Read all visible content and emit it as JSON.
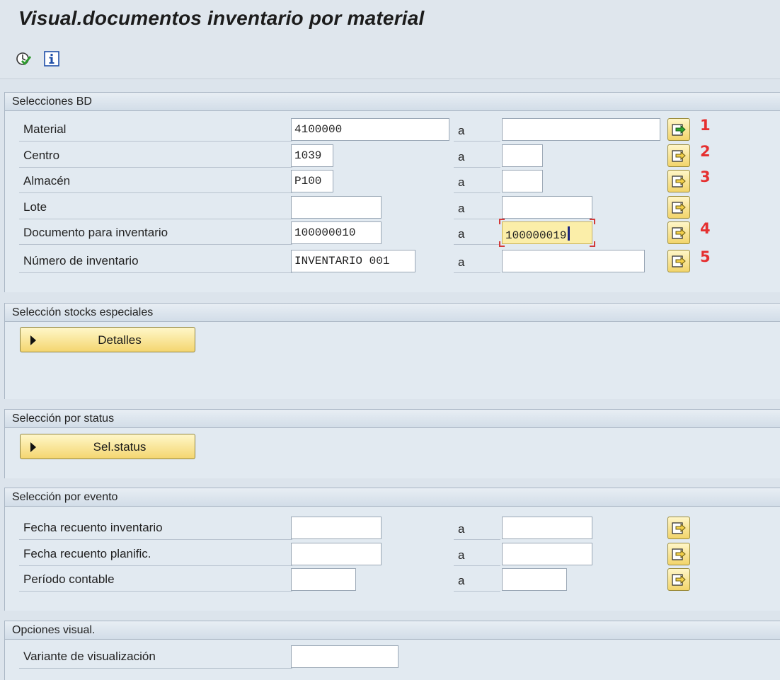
{
  "title": "Visual.documentos inventario por material",
  "toolbar": {
    "icons": [
      "execute-icon",
      "info-icon"
    ]
  },
  "sections": {
    "bd": {
      "header": "Selecciones BD",
      "rows": [
        {
          "label": "Material",
          "from": "4100000",
          "sep": "a",
          "to": "",
          "marker": "1"
        },
        {
          "label": "Centro",
          "from": "1039",
          "sep": "a",
          "to": "",
          "marker": "2"
        },
        {
          "label": "Almacén",
          "from": "P100",
          "sep": "a",
          "to": "",
          "marker": "3"
        },
        {
          "label": "Lote",
          "from": "",
          "sep": "a",
          "to": "",
          "marker": ""
        },
        {
          "label": "Documento para inventario",
          "from": "100000010",
          "sep": "a",
          "to": "100000019",
          "marker": "4"
        },
        {
          "label": "Número de inventario",
          "from": "INVENTARIO 001",
          "sep": "a",
          "to": "",
          "marker": "5"
        }
      ]
    },
    "stocks": {
      "header": "Selección stocks especiales",
      "button": "Detalles"
    },
    "status": {
      "header": "Selección por status",
      "button": "Sel.status"
    },
    "evento": {
      "header": "Selección por evento",
      "rows": [
        {
          "label": "Fecha recuento inventario",
          "from": "",
          "sep": "a",
          "to": ""
        },
        {
          "label": "Fecha recuento planific.",
          "from": "",
          "sep": "a",
          "to": ""
        },
        {
          "label": "Período contable",
          "from": "",
          "sep": "a",
          "to": ""
        }
      ]
    },
    "visual": {
      "header": "Opciones visual.",
      "rows": [
        {
          "label": "Variante de visualización",
          "value": ""
        }
      ]
    }
  },
  "colors": {
    "marker": "#e53030",
    "button": "#f4d670",
    "highlight": "#fbeea9"
  }
}
